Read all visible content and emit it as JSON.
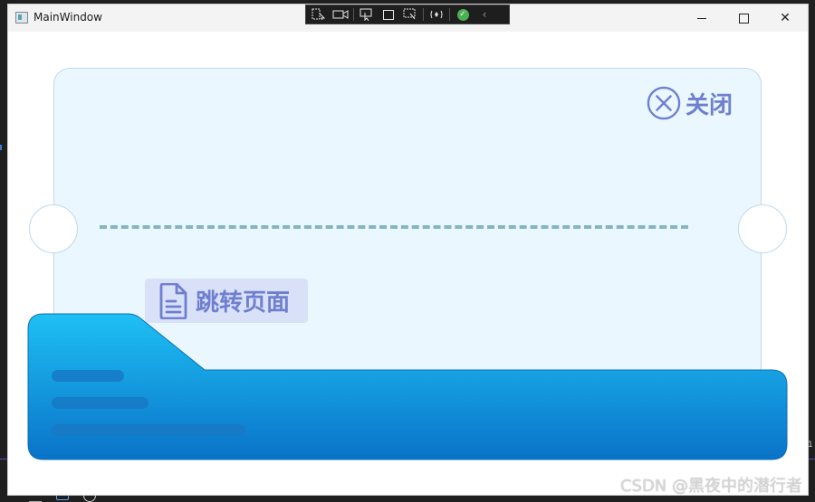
{
  "window": {
    "title": "MainWindow",
    "controls": {
      "minimize": "minimize",
      "maximize": "maximize",
      "close": "✕"
    }
  },
  "debug_toolbar": {
    "icons": [
      "select-element-icon",
      "record-icon",
      "pointer-select-icon",
      "layout-adorner-icon",
      "element-pick-icon",
      "hot-reload-icon",
      "check-icon",
      "collapse-icon"
    ]
  },
  "ticket": {
    "close_label": "关闭",
    "goto_label": "跳转页面"
  },
  "colors": {
    "ticket_bg": "#eaf7fe",
    "ticket_border": "#bfd9ea",
    "accent_text": "#6f7fcf",
    "dash": "#84b6c0",
    "folder_top": "#1ec0f4",
    "folder_bottom": "#0a73c8"
  },
  "watermark": "CSDN @黑夜中的潜行者"
}
